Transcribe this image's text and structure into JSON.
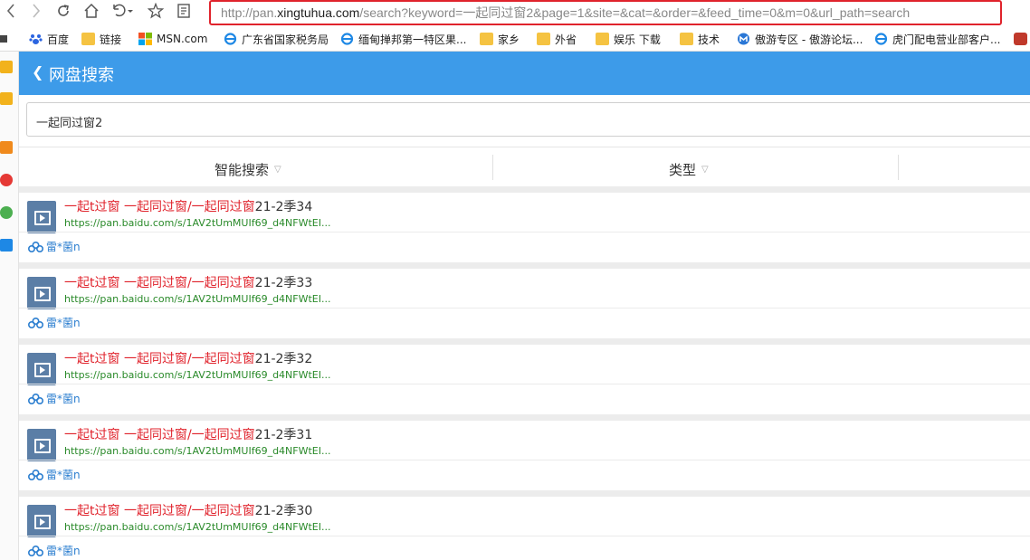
{
  "toolbar": {
    "address_prefix": "http://pan.",
    "address_domain": "xingtuhua.com",
    "address_path": "/search?keyword=一起同过窗2&page=1&site=&cat=&order=&feed_time=0&m=0&url_path=search"
  },
  "bookmarks": [
    {
      "label": "百度",
      "icon": "paw-icon"
    },
    {
      "label": "链接",
      "icon": "folder-icon"
    },
    {
      "label": "MSN.com",
      "icon": "windows-icon"
    },
    {
      "label": "广东省国家税务局",
      "icon": "ie-icon"
    },
    {
      "label": "缅甸掸邦第一特区果...",
      "icon": "ie-icon"
    },
    {
      "label": "家乡",
      "icon": "folder-icon"
    },
    {
      "label": "外省",
      "icon": "folder-icon"
    },
    {
      "label": "娱乐 下载",
      "icon": "folder-icon"
    },
    {
      "label": "技术",
      "icon": "folder-icon"
    },
    {
      "label": "傲游专区 - 傲游论坛...",
      "icon": "maxthon-icon"
    },
    {
      "label": "虎门配电营业部客户...",
      "icon": "ie-icon"
    }
  ],
  "page": {
    "title": "网盘搜索",
    "search_value": "一起同过窗2",
    "filters": [
      {
        "label": "智能搜索"
      },
      {
        "label": "类型"
      }
    ],
    "results": [
      {
        "title_hl": "一起t过窗 一起同过窗/一起同过窗",
        "title_rest": "21-2季34",
        "url": "https://pan.baidu.com/s/1AV2tUmMUIf69_d4NFWtEI...",
        "user": "雷*菌n"
      },
      {
        "title_hl": "一起t过窗 一起同过窗/一起同过窗",
        "title_rest": "21-2季33",
        "url": "https://pan.baidu.com/s/1AV2tUmMUIf69_d4NFWtEI...",
        "user": "雷*菌n"
      },
      {
        "title_hl": "一起t过窗 一起同过窗/一起同过窗",
        "title_rest": "21-2季32",
        "url": "https://pan.baidu.com/s/1AV2tUmMUIf69_d4NFWtEI...",
        "user": "雷*菌n"
      },
      {
        "title_hl": "一起t过窗 一起同过窗/一起同过窗",
        "title_rest": "21-2季31",
        "url": "https://pan.baidu.com/s/1AV2tUmMUIf69_d4NFWtEI...",
        "user": "雷*菌n"
      },
      {
        "title_hl": "一起t过窗 一起同过窗/一起同过窗",
        "title_rest": "21-2季30",
        "url": "https://pan.baidu.com/s/1AV2tUmMUIf69_d4NFWtEI...",
        "user": "雷*菌n"
      }
    ]
  },
  "colors": {
    "header": "#3d9be9",
    "highlight": "#e0232c",
    "url_green": "#2a8a2a",
    "link_blue": "#2d7fd0"
  }
}
